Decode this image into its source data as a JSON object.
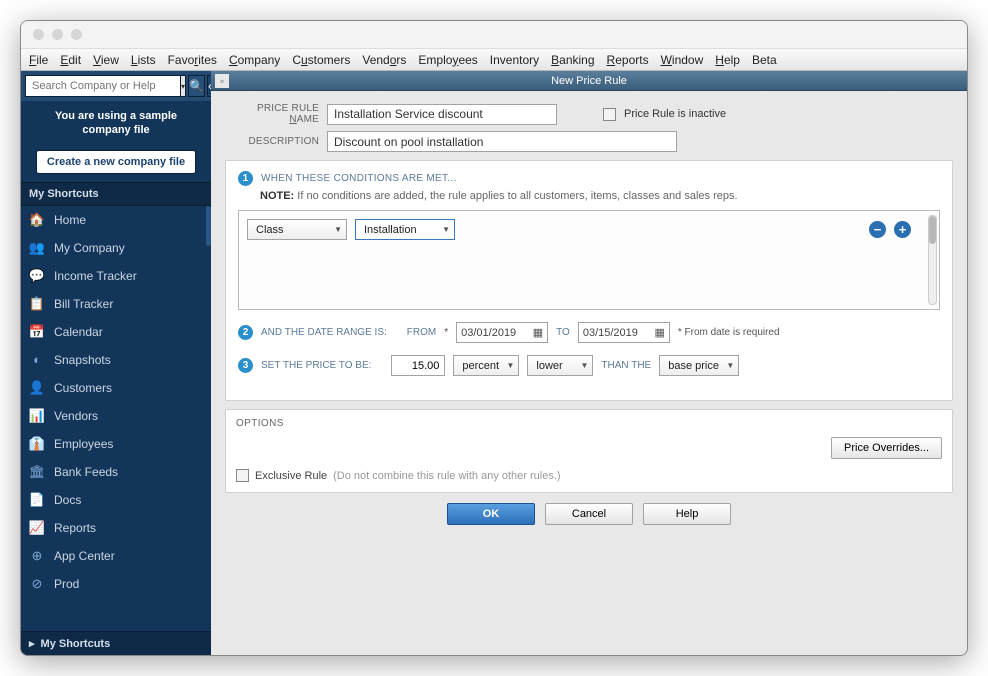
{
  "menu": {
    "file": "File",
    "edit": "Edit",
    "view": "View",
    "lists": "Lists",
    "favorites": "Favorites",
    "company": "Company",
    "customers": "Customers",
    "vendors": "Vendors",
    "employees": "Employees",
    "inventory": "Inventory",
    "banking": "Banking",
    "reports": "Reports",
    "window": "Window",
    "help": "Help",
    "beta": "Beta"
  },
  "sidebar": {
    "search_placeholder": "Search Company or Help",
    "notice_l1": "You are using a sample",
    "notice_l2": "company file",
    "create_btn": "Create a new company file",
    "shortcuts_hdr": "My Shortcuts",
    "shortcuts_hdr2": "My Shortcuts",
    "items": [
      {
        "icon": "🏠",
        "label": "Home"
      },
      {
        "icon": "👥",
        "label": "My Company"
      },
      {
        "icon": "💬",
        "label": "Income Tracker"
      },
      {
        "icon": "📋",
        "label": "Bill Tracker"
      },
      {
        "icon": "📅",
        "label": "Calendar"
      },
      {
        "icon": "◐",
        "label": "Snapshots"
      },
      {
        "icon": "👤",
        "label": "Customers"
      },
      {
        "icon": "📊",
        "label": "Vendors"
      },
      {
        "icon": "👔",
        "label": "Employees"
      },
      {
        "icon": "🏛",
        "label": "Bank Feeds"
      },
      {
        "icon": "📄",
        "label": "Docs"
      },
      {
        "icon": "📈",
        "label": "Reports"
      },
      {
        "icon": "⊕",
        "label": "App Center"
      },
      {
        "icon": "⊘",
        "label": "Prod"
      }
    ]
  },
  "modal": {
    "title": "New Price Rule",
    "name_label_pre": "PRICE RULE ",
    "name_label_u": "N",
    "name_label_post": "AME",
    "name_value": "Installation Service discount",
    "inactive_label": "Price Rule is inactive",
    "desc_label": "DESCRIPTION",
    "desc_value": "Discount on pool installation",
    "step1_hdr": "WHEN THESE CONDITIONS ARE MET...",
    "note_label": "NOTE:",
    "note_text": " If no conditions are added, the rule applies to all customers, items, classes and sales reps.",
    "cond_field": "Class",
    "cond_value": "Installation",
    "step2_hdr": "AND THE DATE RANGE IS:",
    "from_label": "FROM",
    "from_value": "03/01/2019",
    "to_label": "TO",
    "to_value": "03/15/2019",
    "from_required": "From date is required",
    "step3_hdr": "SET THE PRICE TO BE:",
    "amount": "15.00",
    "unit": "percent",
    "direction": "lower",
    "than_label": "THAN THE",
    "basis": "base price",
    "options_hdr": "OPTIONS",
    "override_btn": "Price Overrides...",
    "exclusive_label": "Exclusive Rule",
    "exclusive_hint": "(Do not combine this rule with any other rules.)",
    "ok": "OK",
    "cancel": "Cancel",
    "help": "Help"
  }
}
